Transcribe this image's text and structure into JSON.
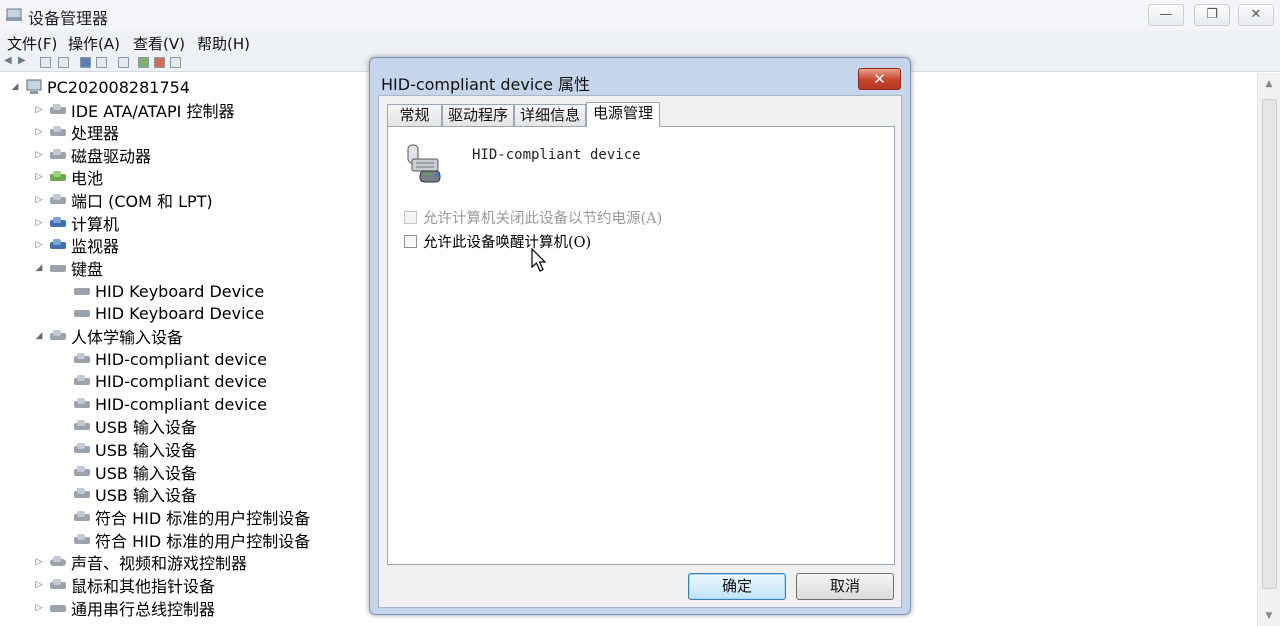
{
  "window": {
    "title": "设备管理器",
    "controls": {
      "minimize": "—",
      "maximize": "❐",
      "close": "✕"
    }
  },
  "menu": [
    "文件(F)",
    "操作(A)",
    "查看(V)",
    "帮助(H)"
  ],
  "tree": {
    "root": "PC202008281754",
    "items": [
      {
        "label": "IDE ATA/ATAPI 控制器",
        "level": 1,
        "state": "collapsed"
      },
      {
        "label": "处理器",
        "level": 1,
        "state": "collapsed"
      },
      {
        "label": "磁盘驱动器",
        "level": 1,
        "state": "collapsed"
      },
      {
        "label": "电池",
        "level": 1,
        "state": "collapsed"
      },
      {
        "label": "端口 (COM 和 LPT)",
        "level": 1,
        "state": "collapsed"
      },
      {
        "label": "计算机",
        "level": 1,
        "state": "collapsed"
      },
      {
        "label": "监视器",
        "level": 1,
        "state": "collapsed"
      },
      {
        "label": "键盘",
        "level": 1,
        "state": "expanded"
      },
      {
        "label": "HID Keyboard Device",
        "level": 2
      },
      {
        "label": "HID Keyboard Device",
        "level": 2
      },
      {
        "label": "人体学输入设备",
        "level": 1,
        "state": "expanded"
      },
      {
        "label": "HID-compliant device",
        "level": 2
      },
      {
        "label": "HID-compliant device",
        "level": 2
      },
      {
        "label": "HID-compliant device",
        "level": 2
      },
      {
        "label": "USB 输入设备",
        "level": 2
      },
      {
        "label": "USB 输入设备",
        "level": 2
      },
      {
        "label": "USB 输入设备",
        "level": 2
      },
      {
        "label": "USB 输入设备",
        "level": 2
      },
      {
        "label": "符合 HID 标准的用户控制设备",
        "level": 2
      },
      {
        "label": "符合 HID 标准的用户控制设备",
        "level": 2
      },
      {
        "label": "声音、视频和游戏控制器",
        "level": 1,
        "state": "collapsed"
      },
      {
        "label": "鼠标和其他指针设备",
        "level": 1,
        "state": "collapsed"
      },
      {
        "label": "通用串行总线控制器",
        "level": 1,
        "state": "collapsed"
      }
    ]
  },
  "dialog": {
    "title": "HID-compliant device 属性",
    "close": "✕",
    "tabs": [
      "常规",
      "驱动程序",
      "详细信息",
      "电源管理"
    ],
    "active_tab": "电源管理",
    "device_name": "HID-compliant device",
    "options": [
      {
        "label": "允许计算机关闭此设备以节约电源(A)",
        "checked": false,
        "enabled": false
      },
      {
        "label": "允许此设备唤醒计算机(O)",
        "checked": false,
        "enabled": true
      }
    ],
    "ok": "确定",
    "cancel": "取消"
  }
}
